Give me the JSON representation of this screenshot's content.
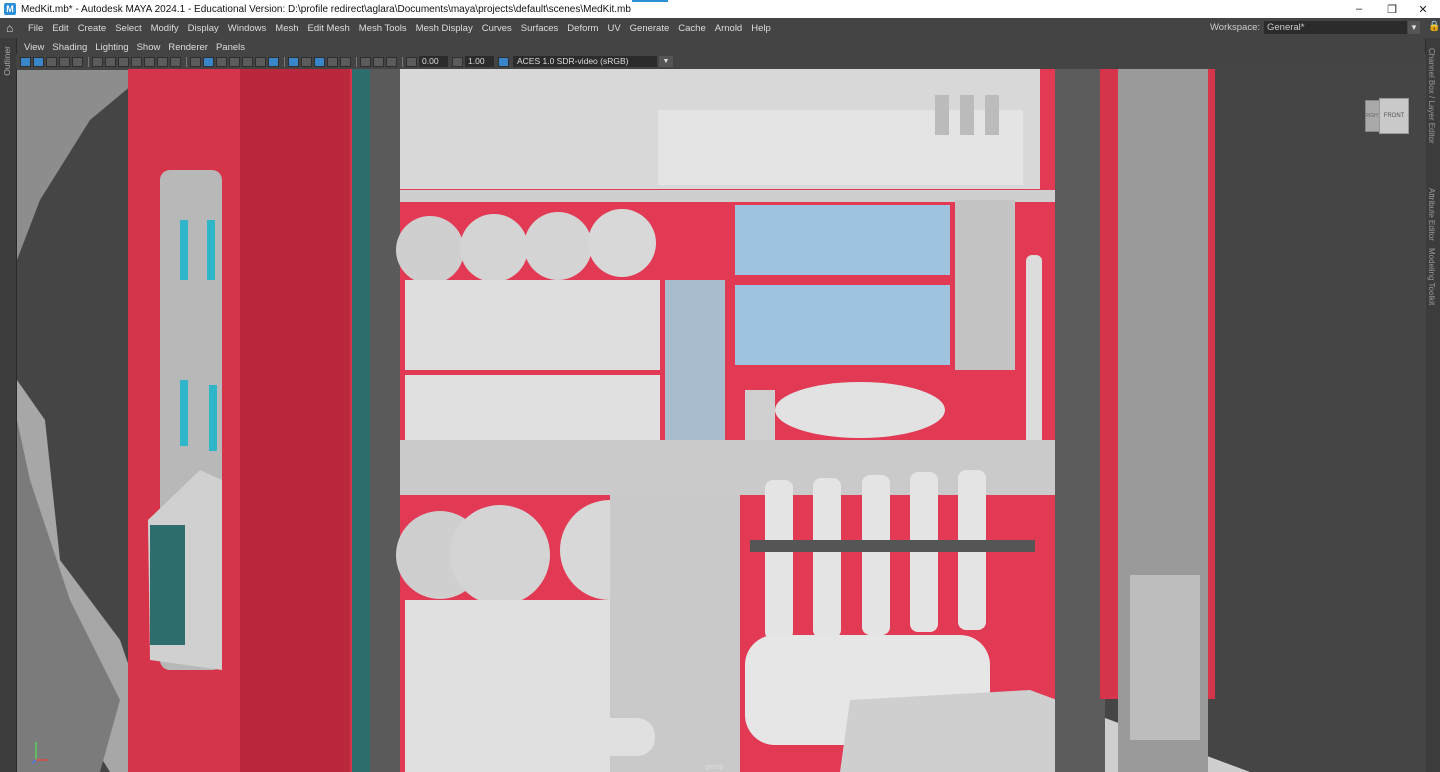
{
  "window": {
    "title": "MedKit.mb* - Autodesk MAYA 2024.1 - Educational Version: D:\\profile redirect\\aglara\\Documents\\maya\\projects\\default\\scenes\\MedKit.mb",
    "app_icon": "M"
  },
  "menu": {
    "items": [
      "File",
      "Edit",
      "Create",
      "Select",
      "Modify",
      "Display",
      "Windows",
      "Mesh",
      "Edit Mesh",
      "Mesh Tools",
      "Mesh Display",
      "Curves",
      "Surfaces",
      "Deform",
      "UV",
      "Generate",
      "Cache",
      "Arnold",
      "Help"
    ]
  },
  "workspace": {
    "label": "Workspace:",
    "value": "General*"
  },
  "left_panel": {
    "outliner_label": "Outliner"
  },
  "right_panel": {
    "tabs": [
      "Channel Box / Layer Editor",
      "Attribute Editor",
      "Modeling Toolkit"
    ]
  },
  "panel_menu": {
    "items": [
      "View",
      "Shading",
      "Lighting",
      "Show",
      "Renderer",
      "Panels"
    ]
  },
  "toolbar": {
    "field_a": "0.00",
    "field_b": "1.00",
    "colorspace": "ACES 1.0 SDR-video (sRGB)"
  },
  "viewport": {
    "view_cube_face": "FRONT",
    "view_cube_side": "RIGHT",
    "camera_label": "persp"
  },
  "colors": {
    "case_red": "#d6344a",
    "case_inner_red": "#e23a55",
    "metal_grey": "#9e9e9e",
    "teal_trim": "#2f6c6c",
    "glass_blue": "#9fc2de",
    "indicator_cyan": "#2fb7c9",
    "accent_blue": "#2b8fd6"
  }
}
